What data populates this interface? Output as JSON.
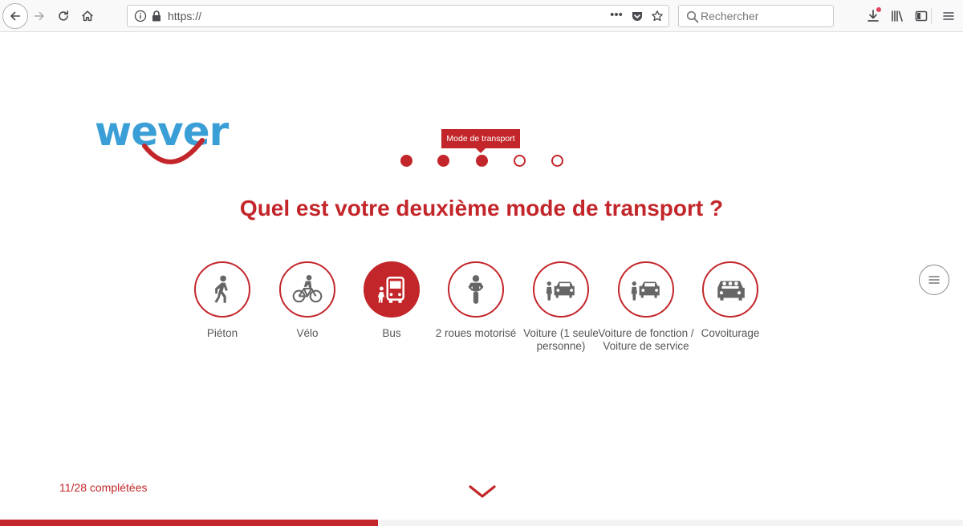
{
  "browser": {
    "url": "https://",
    "search_placeholder": "Rechercher"
  },
  "brand": {
    "logo_text": "wever",
    "colors": {
      "blue": "#3a9fd6",
      "red": "#c3262a"
    }
  },
  "stepper": {
    "tooltip": "Mode de transport",
    "total_steps": 5,
    "completed_steps": 3,
    "current_step": 3
  },
  "question": "Quel est votre deuxième mode de transport ?",
  "options": [
    {
      "label": "Piéton",
      "icon": "pedestrian-icon",
      "selected": false
    },
    {
      "label": "Vélo",
      "icon": "bicycle-icon",
      "selected": false
    },
    {
      "label": "Bus",
      "icon": "bus-icon",
      "selected": true
    },
    {
      "label": "2 roues motorisé",
      "icon": "motorbike-icon",
      "selected": false
    },
    {
      "label": "Voiture (1 seule personne)",
      "icon": "car-person-icon",
      "selected": false
    },
    {
      "label": "Voiture de fonction / Voiture de service",
      "icon": "company-car-icon",
      "selected": false
    },
    {
      "label": "Covoiturage",
      "icon": "carpool-icon",
      "selected": false
    }
  ],
  "progress": {
    "text": "11/28 complétées",
    "completed": 11,
    "total": 28
  }
}
